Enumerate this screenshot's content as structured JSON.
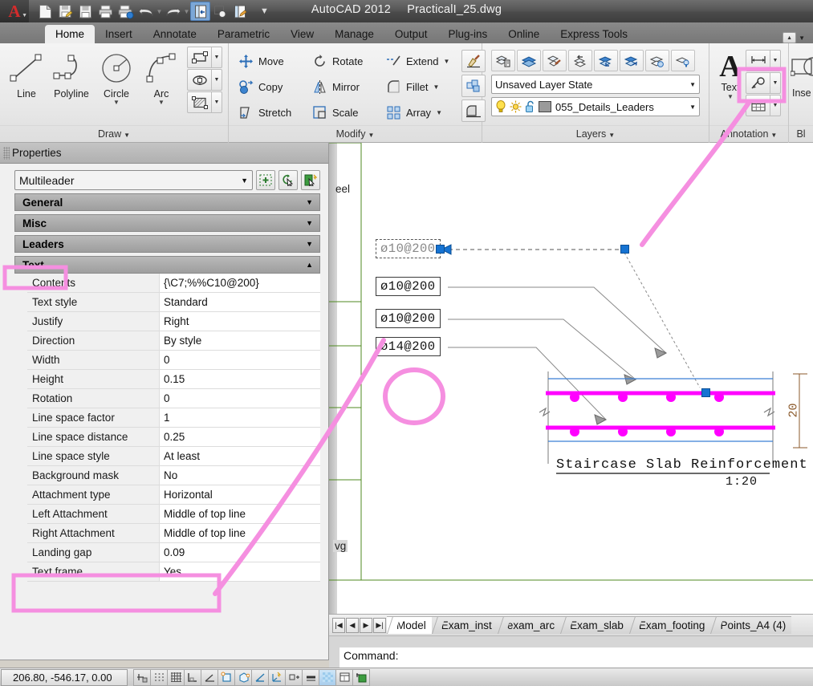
{
  "titlebar": {
    "app_title": "AutoCAD 2012",
    "file_name": "PracticalI_25.dwg",
    "app_logo": "autocad-logo-icon",
    "quick_access": [
      {
        "name": "new-icon",
        "label": "New"
      },
      {
        "name": "save-as-icon",
        "label": "Save As"
      },
      {
        "name": "save-icon",
        "label": "Save"
      },
      {
        "name": "plot-icon",
        "label": "Plot"
      },
      {
        "name": "plot-preview-icon",
        "label": "Plot Preview"
      },
      {
        "name": "undo-icon",
        "label": "Undo"
      },
      {
        "name": "redo-icon",
        "label": "Redo"
      },
      {
        "name": "sheetset-icon",
        "label": "Sheet Set Manager"
      },
      {
        "name": "zoom-window-icon",
        "label": "Zoom"
      },
      {
        "name": "workspace-icon",
        "label": "Workspace"
      }
    ],
    "qat_overflow": "customize-qat-dropdown"
  },
  "ribbon_tabs": {
    "items": [
      {
        "label": "Home",
        "active": true
      },
      {
        "label": "Insert",
        "active": false
      },
      {
        "label": "Annotate",
        "active": false
      },
      {
        "label": "Parametric",
        "active": false
      },
      {
        "label": "View",
        "active": false
      },
      {
        "label": "Manage",
        "active": false
      },
      {
        "label": "Output",
        "active": false
      },
      {
        "label": "Plug-ins",
        "active": false
      },
      {
        "label": "Online",
        "active": false
      },
      {
        "label": "Express Tools",
        "active": false
      }
    ],
    "minimize_label": "minimize-ribbon"
  },
  "panels": {
    "draw": {
      "title": "Draw",
      "buttons": [
        {
          "label": "Line",
          "icon": "line-icon",
          "dropdown": false
        },
        {
          "label": "Polyline",
          "icon": "polyline-icon",
          "dropdown": false
        },
        {
          "label": "Circle",
          "icon": "circle-icon",
          "dropdown": true
        },
        {
          "label": "Arc",
          "icon": "arc-icon",
          "dropdown": true
        }
      ],
      "small_buttons": [
        {
          "icon": "rectangle-icon",
          "label": "Rectangle"
        },
        {
          "icon": "ellipse-icon",
          "label": "Ellipse"
        },
        {
          "icon": "hatch-icon",
          "label": "Hatch"
        }
      ]
    },
    "modify": {
      "title": "Modify",
      "items": [
        {
          "label": "Move",
          "icon": "move-icon",
          "dropdown": false
        },
        {
          "label": "Rotate",
          "icon": "rotate-icon",
          "dropdown": false
        },
        {
          "label": "Extend",
          "icon": "extend-icon",
          "dropdown": true
        },
        {
          "label": "Copy",
          "icon": "copy-icon",
          "dropdown": false
        },
        {
          "label": "Mirror",
          "icon": "mirror-icon",
          "dropdown": false
        },
        {
          "label": "Fillet",
          "icon": "fillet-icon",
          "dropdown": true
        },
        {
          "label": "Stretch",
          "icon": "stretch-icon",
          "dropdown": false
        },
        {
          "label": "Scale",
          "icon": "scale-icon",
          "dropdown": false
        },
        {
          "label": "Array",
          "icon": "array-icon",
          "dropdown": true
        }
      ],
      "side_buttons": [
        {
          "icon": "match-properties-icon",
          "label": "Match Properties"
        },
        {
          "icon": "explode-icon",
          "label": "Explode"
        },
        {
          "icon": "edit-polyline-icon",
          "label": "Edit Polyline"
        }
      ]
    },
    "layers": {
      "title": "Layers",
      "tool_buttons": [
        {
          "icon": "layer-properties-icon",
          "label": "Layer Properties"
        },
        {
          "icon": "layer-make-current-icon",
          "label": "Make Current"
        },
        {
          "icon": "layer-match-icon",
          "label": "Match Layer"
        },
        {
          "icon": "layer-previous-icon",
          "label": "Layer Previous"
        },
        {
          "icon": "layer-isolate-icon",
          "label": "Isolate"
        },
        {
          "icon": "layer-unisolate-icon",
          "label": "Unisolate"
        },
        {
          "icon": "layer-freeze-icon",
          "label": "Freeze"
        },
        {
          "icon": "layer-off-icon",
          "label": "Layer Off"
        }
      ],
      "layer_state": "Unsaved Layer State",
      "current_layer": "055_Details_Leaders",
      "layer_state_icons": [
        {
          "icon": "lightbulb-icon",
          "label": "On/Off"
        },
        {
          "icon": "sun-icon",
          "label": "Freeze/Thaw"
        },
        {
          "icon": "unlock-icon",
          "label": "Lock/Unlock"
        },
        {
          "icon": "color-swatch-icon",
          "label": "Color"
        }
      ]
    },
    "annotation": {
      "title": "Annotation",
      "text_label": "Text",
      "text_icon": "text-A-icon",
      "stack": [
        {
          "icon": "dimension-icon",
          "label": "Dimension",
          "highlighted": false
        },
        {
          "icon": "leader-icon",
          "label": "Leader",
          "highlighted": true
        },
        {
          "icon": "table-icon",
          "label": "Table",
          "highlighted": false
        }
      ]
    },
    "block": {
      "title": "Bl",
      "insert_label": "Inse",
      "insert_icon": "insert-block-icon"
    }
  },
  "properties": {
    "title": "Properties",
    "object_type": "Multileader",
    "header_buttons": [
      {
        "icon": "toggle-pickadd-icon",
        "label": "Toggle PickAdd"
      },
      {
        "icon": "select-objects-icon",
        "label": "Select Objects"
      },
      {
        "icon": "quick-select-icon",
        "label": "Quick Select"
      }
    ],
    "categories": [
      {
        "label": "General",
        "expanded": false
      },
      {
        "label": "Misc",
        "expanded": false
      },
      {
        "label": "Leaders",
        "expanded": false
      },
      {
        "label": "Text",
        "expanded": true,
        "highlighted": true
      }
    ],
    "text_rows": [
      {
        "key": "Contents",
        "value": "{\\C7;%%C10@200}"
      },
      {
        "key": "Text style",
        "value": "Standard"
      },
      {
        "key": "Justify",
        "value": "Right"
      },
      {
        "key": "Direction",
        "value": "By style"
      },
      {
        "key": "Width",
        "value": "0"
      },
      {
        "key": "Height",
        "value": "0.15"
      },
      {
        "key": "Rotation",
        "value": "0"
      },
      {
        "key": "Line space factor",
        "value": "1"
      },
      {
        "key": "Line space distance",
        "value": "0.25"
      },
      {
        "key": "Line space style",
        "value": "At least"
      },
      {
        "key": "Background mask",
        "value": "No"
      },
      {
        "key": "Attachment type",
        "value": "Horizontal"
      },
      {
        "key": "Left Attachment",
        "value": "Middle of top line"
      },
      {
        "key": "Right Attachment",
        "value": "Middle of top line"
      },
      {
        "key": "Landing gap",
        "value": "0.09"
      },
      {
        "key": "Text frame",
        "value": "Yes",
        "highlighted": true
      }
    ]
  },
  "canvas": {
    "leader_labels": [
      {
        "text": "ø10@200",
        "selected": true
      },
      {
        "text": "ø10@200",
        "selected": false
      },
      {
        "text": "ø10@200",
        "selected": false
      },
      {
        "text": "ø14@200",
        "selected": false
      }
    ],
    "detail_title": "Staircase  Slab  Reinforcement",
    "detail_scale": "1:20",
    "dimension_value": "20",
    "background_text_left": "eel",
    "background_text_left2": "vg"
  },
  "layout_tabs": {
    "nav_buttons": [
      {
        "icon": "first-tab-icon",
        "glyph": "⏮"
      },
      {
        "icon": "prev-tab-icon",
        "glyph": "◀"
      },
      {
        "icon": "next-tab-icon",
        "glyph": "▶"
      },
      {
        "icon": "last-tab-icon",
        "glyph": "⏭"
      }
    ],
    "items": [
      {
        "label": "Model",
        "active": true
      },
      {
        "label": "Exam_inst",
        "active": false
      },
      {
        "label": "exam_arc",
        "active": false
      },
      {
        "label": "Exam_slab",
        "active": false
      },
      {
        "label": "Exam_footing",
        "active": false
      },
      {
        "label": "Points_A4 (4)",
        "active": false
      }
    ]
  },
  "command_line": {
    "prompt": "Command:"
  },
  "statusbar": {
    "coordinates": "206.80, -546.17, 0.00",
    "toggles": [
      {
        "icon": "infer-constraints-icon",
        "on": false
      },
      {
        "icon": "snap-mode-icon",
        "on": false
      },
      {
        "icon": "grid-display-icon",
        "on": false
      },
      {
        "icon": "ortho-mode-icon",
        "on": false
      },
      {
        "icon": "polar-tracking-icon",
        "on": false
      },
      {
        "icon": "object-snap-icon",
        "on": false
      },
      {
        "icon": "3d-object-snap-icon",
        "on": false
      },
      {
        "icon": "object-snap-tracking-icon",
        "on": false
      },
      {
        "icon": "dynamic-ucs-icon",
        "on": false
      },
      {
        "icon": "dynamic-input-icon",
        "on": false
      },
      {
        "icon": "lineweight-icon",
        "on": false
      },
      {
        "icon": "transparency-icon",
        "on": true
      },
      {
        "icon": "quick-properties-icon",
        "on": false
      },
      {
        "icon": "selection-cycling-icon",
        "on": false
      }
    ]
  },
  "colors": {
    "accent_pink": "#f58fe0",
    "grip_blue": "#1673d2",
    "rebar_magenta": "#ff00ff",
    "slab_blue": "#3a7fd5",
    "dim_brown": "#8b5a2b",
    "layer_green": "#4f8a20"
  }
}
